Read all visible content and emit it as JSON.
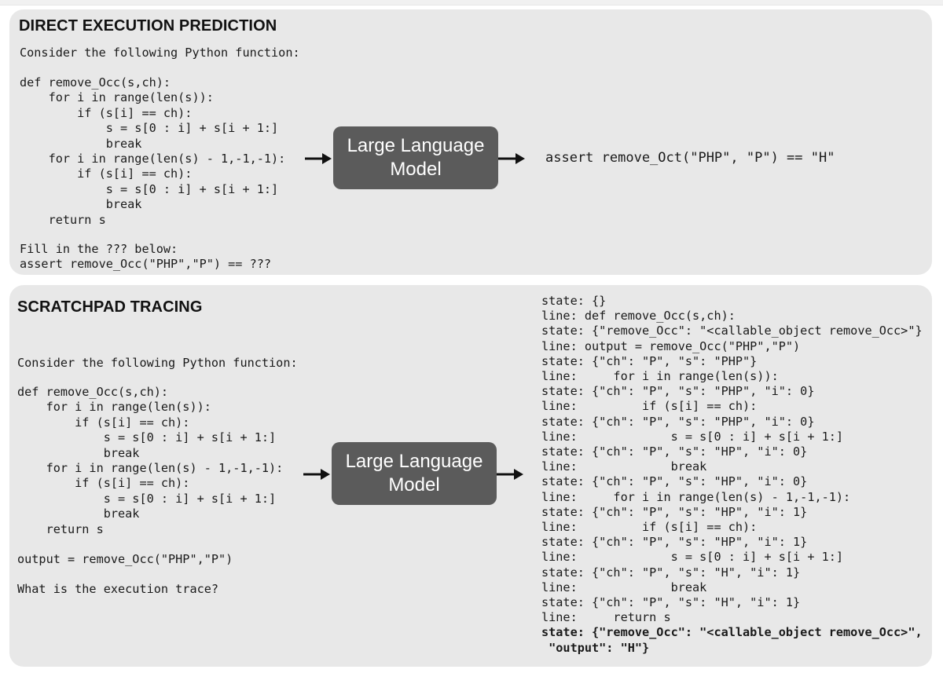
{
  "direct": {
    "title": "DIRECT EXECUTION PREDICTION",
    "intro": "Consider the following Python function:",
    "code": [
      "def remove_Occ(s,ch):",
      "    for i in range(len(s)):",
      "        if (s[i] == ch):",
      "            s = s[0 : i] + s[i + 1:]",
      "            break",
      "    for i in range(len(s) - 1,-1,-1):",
      "        if (s[i] == ch):",
      "            s = s[0 : i] + s[i + 1:]",
      "            break",
      "    return s"
    ],
    "prompt": [
      "Fill in the ??? below:",
      "assert remove_Occ(\"PHP\",\"P\") == ???"
    ],
    "model_label": [
      "Large Language",
      "Model"
    ],
    "output": "assert remove_Oct(\"PHP\", \"P\") == \"H\""
  },
  "scratchpad": {
    "title": "SCRATCHPAD TRACING",
    "intro": "Consider the following Python function:",
    "code": [
      "def remove_Occ(s,ch):",
      "    for i in range(len(s)):",
      "        if (s[i] == ch):",
      "            s = s[0 : i] + s[i + 1:]",
      "            break",
      "    for i in range(len(s) - 1,-1,-1):",
      "        if (s[i] == ch):",
      "            s = s[0 : i] + s[i + 1:]",
      "            break",
      "    return s"
    ],
    "output_stmt": "output = remove_Occ(\"PHP\",\"P\")",
    "question": "What is the execution trace?",
    "model_label": [
      "Large Language",
      "Model"
    ],
    "trace": [
      "state: {}",
      "line: def remove_Occ(s,ch):",
      "state: {\"remove_Occ\": \"<callable_object remove_Occ>\"}",
      "line: output = remove_Occ(\"PHP\",\"P\")",
      "state: {\"ch\": \"P\", \"s\": \"PHP\"}",
      "line:     for i in range(len(s)):",
      "state: {\"ch\": \"P\", \"s\": \"PHP\", \"i\": 0}",
      "line:         if (s[i] == ch):",
      "state: {\"ch\": \"P\", \"s\": \"PHP\", \"i\": 0}",
      "line:             s = s[0 : i] + s[i + 1:]",
      "state: {\"ch\": \"P\", \"s\": \"HP\", \"i\": 0}",
      "line:             break",
      "state: {\"ch\": \"P\", \"s\": \"HP\", \"i\": 0}",
      "line:     for i in range(len(s) - 1,-1,-1):",
      "state: {\"ch\": \"P\", \"s\": \"HP\", \"i\": 1}",
      "line:         if (s[i] == ch):",
      "state: {\"ch\": \"P\", \"s\": \"HP\", \"i\": 1}",
      "line:             s = s[0 : i] + s[i + 1:]",
      "state: {\"ch\": \"P\", \"s\": \"H\", \"i\": 1}",
      "line:             break",
      "state: {\"ch\": \"P\", \"s\": \"H\", \"i\": 1}",
      "line:     return s"
    ],
    "final_state": [
      "state: {\"remove_Occ\": \"<callable_object remove_Occ>\",",
      " \"output\": \"H\"}"
    ]
  }
}
